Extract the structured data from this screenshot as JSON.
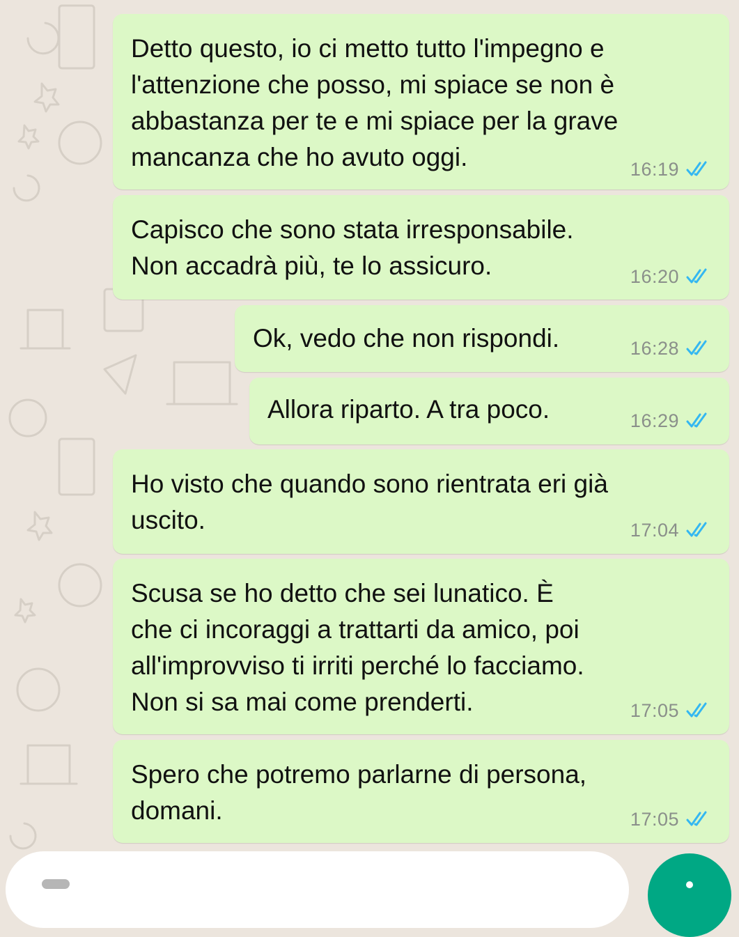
{
  "chat": {
    "messages": [
      {
        "text": "Detto questo, io ci metto tutto l'impegno e\nl'attenzione che posso, mi spiace se non è\nabbastanza per te e mi spiace per la grave\nmancanza che ho avuto oggi.",
        "time": "16:19",
        "status": "read"
      },
      {
        "text": "Capisco che sono stata irresponsabile.\nNon accadrà più, te lo assicuro.",
        "time": "16:20",
        "status": "read"
      },
      {
        "text": "Ok, vedo che non rispondi.",
        "time": "16:28",
        "status": "read"
      },
      {
        "text": "Allora riparto. A tra poco.",
        "time": "16:29",
        "status": "read"
      },
      {
        "text": "Ho visto che quando sono rientrata eri già\nuscito.",
        "time": "17:04",
        "status": "read"
      },
      {
        "text": "Scusa se ho detto che sei lunatico. È\nche ci incoraggi a trattarti da amico, poi\nall'improvviso ti irriti perché lo facciamo.\nNon si sa mai come prenderti.",
        "time": "17:05",
        "status": "read"
      },
      {
        "text": "Spero che potremo parlarne di persona,\ndomani.",
        "time": "17:05",
        "status": "read"
      }
    ]
  },
  "icons": {
    "read_receipt": "double-check-icon",
    "send": "mic-icon"
  },
  "colors": {
    "outgoing_bubble": "#dcf8c6",
    "background": "#ece5dd",
    "read_ticks": "#34b7f1",
    "timestamp": "#8a8f8a",
    "accent": "#00a884"
  }
}
